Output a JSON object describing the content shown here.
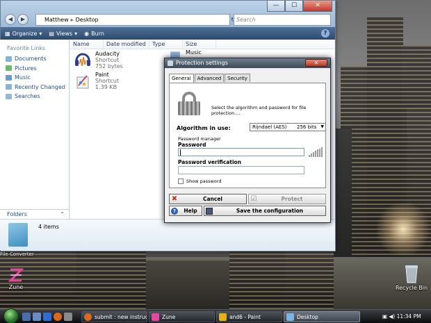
{
  "explorer": {
    "window_controls": {
      "minimize": "—",
      "maximize": "☐",
      "close": "✕"
    },
    "breadcrumb": [
      "Matthew",
      "Desktop"
    ],
    "search_placeholder": "Search",
    "toolbar": {
      "organize": "Organize",
      "views": "Views",
      "burn": "Burn"
    },
    "help_icon": "?",
    "favorite_links_header": "Favorite Links",
    "favorite_links": [
      {
        "label": "Documents",
        "icon": "documents-icon"
      },
      {
        "label": "Pictures",
        "icon": "pictures-icon"
      },
      {
        "label": "Music",
        "icon": "music-icon"
      },
      {
        "label": "Recently Changed",
        "icon": "recent-icon"
      },
      {
        "label": "Searches",
        "icon": "searches-icon"
      }
    ],
    "folders_label": "Folders",
    "columns": [
      "Name",
      "Date modified",
      "Type",
      "Size"
    ],
    "files": [
      {
        "name": "Audacity",
        "type": "Shortcut",
        "size": "752 bytes"
      },
      {
        "name": "Paint",
        "type": "Shortcut",
        "size": "1.39 KB"
      },
      {
        "name": "Music"
      }
    ],
    "item_count": "4 items"
  },
  "dialog": {
    "title": "Protection settings",
    "tabs": [
      "General",
      "Advanced",
      "Security"
    ],
    "active_tab": "General",
    "description": "Select the algorithm and password for file protection....",
    "algorithm_label": "Algorithm in use:",
    "algorithm_value": "Rijndael (AES)",
    "algorithm_bits": "256 bits",
    "password_manager_label": "Password manager",
    "password_label": "Password",
    "password_value": "",
    "verification_label": "Password verification",
    "verification_value": "",
    "show_password_label": "Show password",
    "show_password_checked": false,
    "buttons": {
      "cancel": "Cancel",
      "protect": "Protect",
      "help": "Help",
      "save": "Save the configuration"
    }
  },
  "desktop": {
    "icons": [
      {
        "label": "Zune",
        "icon": "zune-icon"
      },
      {
        "label": "Recycle Bin",
        "icon": "recycle-bin-icon"
      }
    ],
    "partial_label": "File Converter"
  },
  "taskbar": {
    "tasks": [
      {
        "label": "submit : new instruc...",
        "icon": "firefox-icon"
      },
      {
        "label": "Zune",
        "icon": "zune-icon"
      },
      {
        "label": "and6 - Paint",
        "icon": "paint-icon"
      },
      {
        "label": "Desktop",
        "icon": "folder-icon",
        "active": true
      }
    ],
    "clock": "11:34 PM"
  },
  "colors": {
    "accent": "#2c4a70",
    "link": "#1b4d9a",
    "cancel_icon": "#c0392b",
    "help_icon": "#2a5fb0"
  }
}
